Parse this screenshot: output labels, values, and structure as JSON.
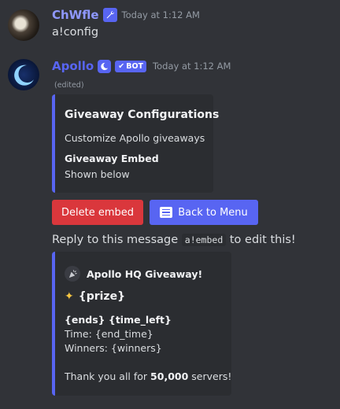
{
  "messages": [
    {
      "author": "ChWfle",
      "author_color": "#8f98ff",
      "author_badge_icon": "wrench-icon",
      "timestamp": "Today at 1:12 AM",
      "content": "a!config"
    },
    {
      "author": "Apollo",
      "author_color": "#5865f2",
      "author_badge_icon": "crescent-moon-icon",
      "bot_tag": "BOT",
      "timestamp": "Today at 1:12 AM",
      "edited": "(edited)",
      "embed": {
        "accent_color": "#5865f2",
        "title": "Giveaway Configurations",
        "description": "Customize Apollo giveaways",
        "field_name": "Giveaway Embed",
        "field_value": "Shown below"
      },
      "buttons": [
        {
          "label": "Delete embed",
          "style": "danger",
          "color": "#da373c"
        },
        {
          "label": "Back to Menu",
          "style": "primary",
          "color": "#5865f2",
          "icon": "menu-icon"
        }
      ],
      "reply_hint": {
        "before": "Reply to this message",
        "code": "a!embed",
        "after": "to edit this!"
      },
      "preview_embed": {
        "accent_color": "#5865f2",
        "author_icon": "party-popper-icon",
        "author_name": "Apollo HQ Giveaway!",
        "title_icon": "sparkle-icon",
        "title": "{prize}",
        "bold_line": "{ends} {time_left}",
        "line1": "Time: {end_time}",
        "line2": "Winners: {winners}",
        "footer_before": "Thank you all for",
        "footer_bold": "50,000",
        "footer_after": "servers!"
      }
    }
  ]
}
